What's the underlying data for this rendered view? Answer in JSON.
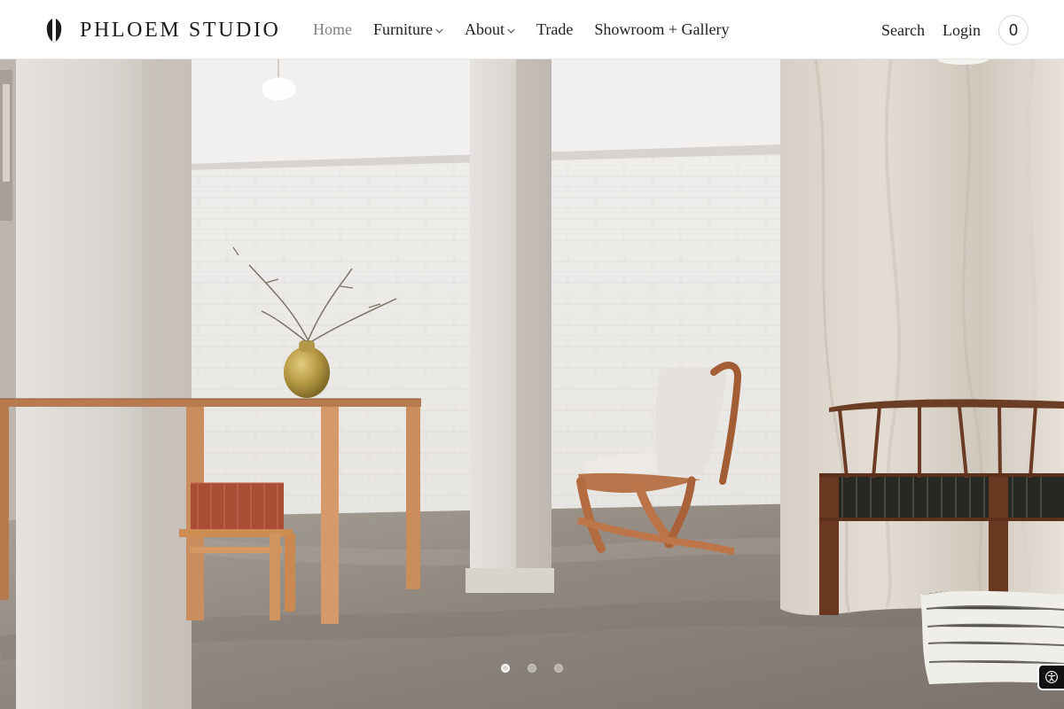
{
  "header": {
    "brand": "PHLOEM STUDIO",
    "nav": [
      {
        "label": "Home",
        "active": true,
        "has_dropdown": false
      },
      {
        "label": "Furniture",
        "active": false,
        "has_dropdown": true
      },
      {
        "label": "About",
        "active": false,
        "has_dropdown": true
      },
      {
        "label": "Trade",
        "active": false,
        "has_dropdown": false
      },
      {
        "label": "Showroom + Gallery",
        "active": false,
        "has_dropdown": false
      }
    ],
    "utility": {
      "search_label": "Search",
      "login_label": "Login",
      "cart_count": "0"
    }
  },
  "hero": {
    "slides_total": 3,
    "active_slide": 1
  },
  "icons": {
    "logo": "leaf-logo-icon",
    "dropdown": "chevron-down-icon",
    "accessibility": "accessibility-icon"
  },
  "colors": {
    "text": "#202020",
    "active_nav": "#808080",
    "header_background": "#ffffff",
    "accessibility_button": "#111111"
  }
}
